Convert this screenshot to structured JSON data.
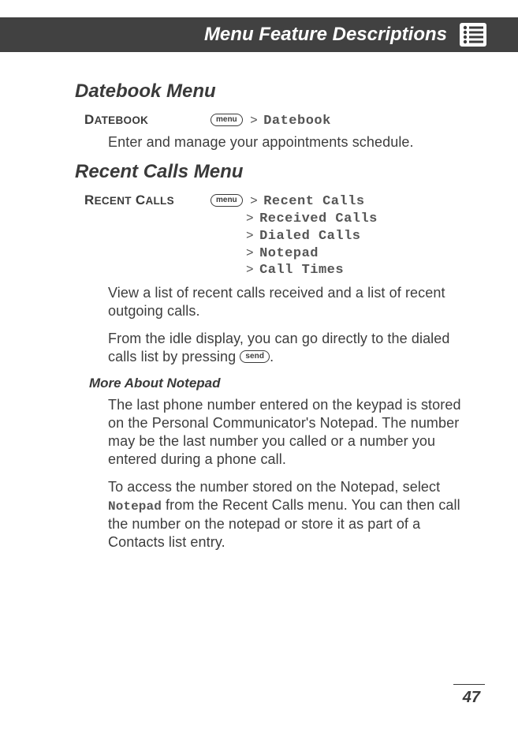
{
  "header": {
    "title": "Menu Feature Descriptions"
  },
  "sections": {
    "datebook": {
      "heading": "Datebook Menu",
      "feature_label_first": "D",
      "feature_label_rest": "ATEBOOK",
      "menu_button": "menu",
      "path": "Datebook",
      "body1": "Enter and manage your appointments schedule."
    },
    "recent": {
      "heading": "Recent Calls Menu",
      "feature_label_first": "R",
      "feature_label_mid": "ECENT",
      "feature_label_first2": "C",
      "feature_label_rest2": "ALLS",
      "menu_button": "menu",
      "path": "Recent Calls",
      "sub1": "Received Calls",
      "sub2": "Dialed Calls",
      "sub3": "Notepad",
      "sub4": "Call Times",
      "body1": "View a list of recent calls received and a list of recent outgoing calls.",
      "body2a": "From the idle display, you can go directly to the dialed calls list by pressing ",
      "send_button": "send",
      "body2b": ".",
      "more_heading": "More About Notepad",
      "body3": "The last phone number entered on the keypad is stored on the Personal Communicator's Notepad. The number may be the last number you called or a number you entered during a phone call.",
      "body4a": "To access the number stored on the Notepad, select ",
      "body4_mono": "Notepad",
      "body4b": " from the Recent Calls menu. You can then call the number on the notepad or store it as part of a Contacts list entry."
    }
  },
  "page_number": "47"
}
